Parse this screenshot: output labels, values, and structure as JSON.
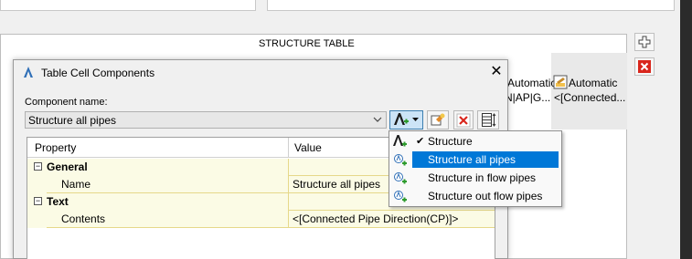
{
  "background": {
    "table_title": "STRUCTURE TABLE",
    "cells": {
      "automatic_1": "Automatic",
      "automatic_2": "Automatic",
      "row2_left": "N|AP|G...",
      "row2_right": "<[Connected..."
    },
    "side_buttons": {
      "add_icon": "plus-icon",
      "delete_icon": "red-x-icon"
    }
  },
  "dialog": {
    "title": "Table Cell Components",
    "close_glyph": "✕",
    "component_name_label": "Component name:",
    "component_name_value": "Structure all pipes",
    "toolbar": {
      "insert_component_icon": "text-component-icon",
      "copy_icon": "copy-component-icon",
      "delete_icon": "delete-x-icon",
      "properties_icon": "column-properties-icon"
    },
    "grid": {
      "header_property": "Property",
      "header_value": "Value",
      "categories": [
        {
          "name": "General",
          "toggle": "−",
          "rows": [
            {
              "name": "Name",
              "value": "Structure all pipes"
            }
          ]
        },
        {
          "name": "Text",
          "toggle": "−",
          "rows": [
            {
              "name": "Contents",
              "value": "<[Connected Pipe Direction(CP)]>"
            }
          ]
        }
      ]
    }
  },
  "dropdown_menu": {
    "items": [
      {
        "label": "Structure",
        "checked": true,
        "check_glyph": "✔",
        "icon": "text-A-plus-icon"
      },
      {
        "label": "Structure all pipes",
        "checked": false,
        "selected": true,
        "icon": "pipe-component-icon"
      },
      {
        "label": "Structure in flow pipes",
        "checked": false,
        "icon": "pipe-component-icon"
      },
      {
        "label": "Structure out flow pipes",
        "checked": false,
        "icon": "pipe-component-icon"
      }
    ]
  },
  "colors": {
    "selection": "#0078d7",
    "grid_category_bg": "#fbfbe5",
    "delete_red": "#d9261c",
    "add_green": "#2e9b2e"
  }
}
